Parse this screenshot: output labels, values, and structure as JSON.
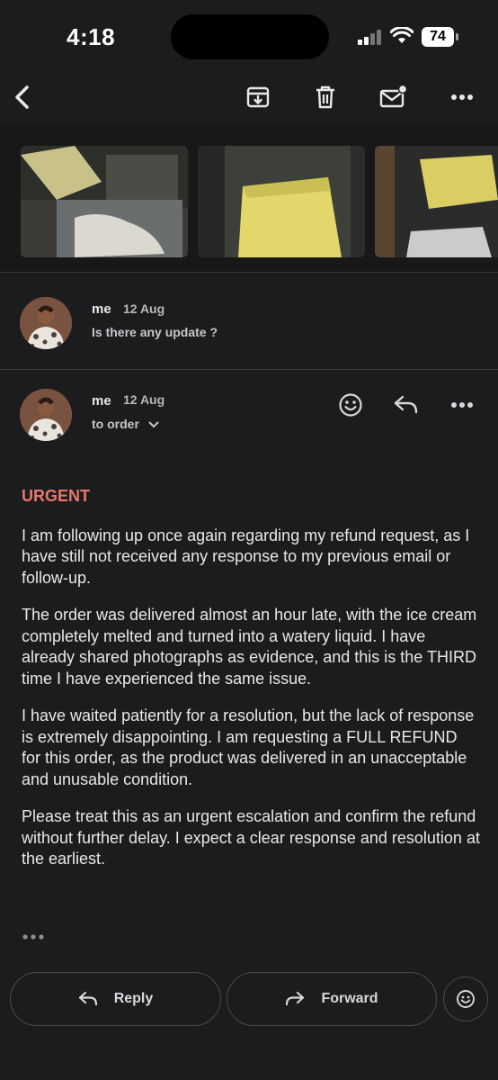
{
  "status_bar": {
    "time": "4:18",
    "battery": "74"
  },
  "toolbar": {
    "icons": [
      "back-arrow-icon",
      "archive-icon",
      "delete-icon",
      "mark-unread-icon",
      "more-icon"
    ]
  },
  "attachments": [
    {
      "name": "ice-cream-photo-1"
    },
    {
      "name": "ice-cream-photo-2"
    },
    {
      "name": "ice-cream-photo-3"
    }
  ],
  "collapsed_message": {
    "sender": "me",
    "date": "12 Aug",
    "snippet": "Is there any update ?"
  },
  "expanded_message": {
    "sender": "me",
    "date": "12 Aug",
    "recipient": "to order",
    "urgent_label": "URGENT",
    "paragraphs": [
      "I am following up once again regarding my refund request, as I have still not received any response to my previous email or follow-up.",
      "The order was delivered almost an hour late, with the ice cream completely melted and turned into a watery liquid. I have already shared photographs as evidence, and this is the THIRD time I have experienced the same issue.",
      "I have waited patiently for a resolution, but the lack of response is extremely disappointing. I am requesting a FULL REFUND for this order, as the product was delivered in an unacceptable and unusable condition.",
      "Please treat this as an urgent escalation and confirm the refund without further delay. I expect a clear response and resolution at the earliest."
    ]
  },
  "actions": {
    "reply_label": "Reply",
    "forward_label": "Forward"
  },
  "colors": {
    "background": "#1c1c1e",
    "urgent": "#e8776c",
    "text": "#e8e8ea"
  }
}
